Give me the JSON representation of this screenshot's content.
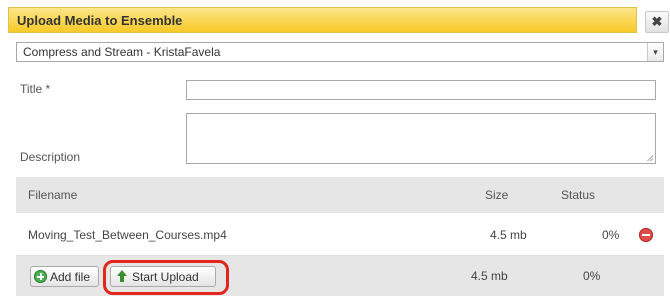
{
  "dialog": {
    "title": "Upload Media to Ensemble",
    "close_glyph": "✖"
  },
  "destination": {
    "selected": "Compress and Stream - KristaFavela",
    "arrow_glyph": "▾"
  },
  "form": {
    "title_label": "Title *",
    "title_value": "",
    "description_label": "Description",
    "description_value": ""
  },
  "table": {
    "headers": {
      "filename": "Filename",
      "size": "Size",
      "status": "Status"
    },
    "rows": [
      {
        "filename": "Moving_Test_Between_Courses.mp4",
        "size": "4.5 mb",
        "status": "0%"
      }
    ]
  },
  "footer": {
    "add_file_label": "Add file",
    "start_upload_label": "Start Upload",
    "total_size": "4.5 mb",
    "total_status": "0%"
  },
  "icons": {
    "add": "add-circle-icon",
    "upload": "up-arrow-icon",
    "remove": "remove-circle-icon",
    "close": "close-icon"
  },
  "colors": {
    "titlebar": "#f7c928",
    "highlight": "#e3261b",
    "remove": "#e04b4b",
    "add": "#4caf50"
  }
}
